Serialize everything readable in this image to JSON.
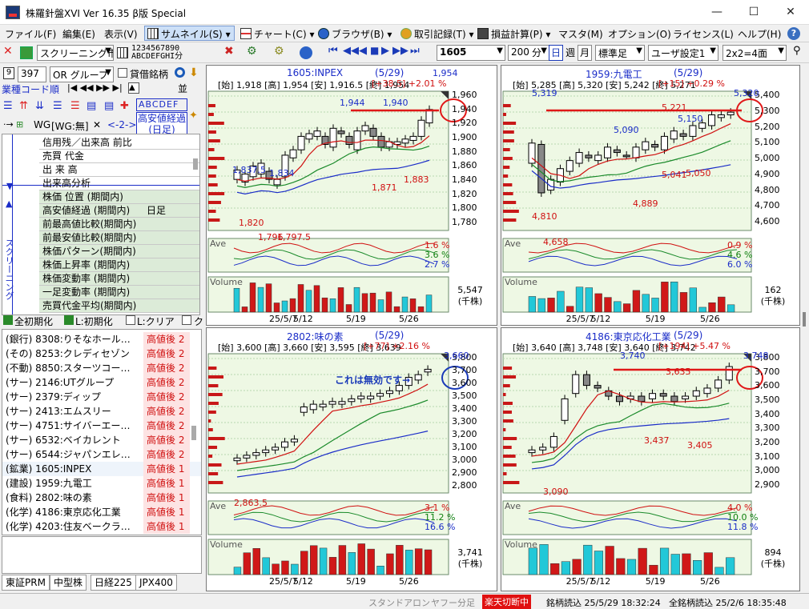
{
  "window": {
    "title": "株羅針盤XVI Ver 16.35 β版  Special",
    "min": "—",
    "max": "☐",
    "close": "✕"
  },
  "menu": [
    {
      "label": "ファイル(F)"
    },
    {
      "label": "編集(E)"
    },
    {
      "label": "表示(V)"
    },
    {
      "label": "サムネイル(S)"
    },
    {
      "label": "チャート(C)"
    },
    {
      "label": "ブラウザ(B)"
    },
    {
      "label": "取引記録(T)"
    },
    {
      "label": "損益計算(P)"
    },
    {
      "label": "マスタ(M)"
    },
    {
      "label": "オプション(O)"
    },
    {
      "label": "ライセンス(L)"
    },
    {
      "label": "ヘルプ(H)"
    }
  ],
  "toolbar": {
    "market": "スクリーニング市場",
    "digits_top": "1234567890",
    "digits_bottom": "ABCDEFGHI分",
    "code": "1605",
    "bars": "200",
    "unit": "分",
    "tf_day": "日",
    "tf_week": "週",
    "tf_month": "月",
    "standard": "標準足",
    "user": "ユーザ設定1",
    "layout": "2x2=4面"
  },
  "left": {
    "count": "397",
    "orgroup": "OR グループ",
    "lending": "貸借銘柄",
    "sector": "業種コード順",
    "abc": "ABCDEF",
    "wg": "WG",
    "wgnone": "[WG:無]",
    "nav": "<-2->",
    "high_low": "高安値経過",
    "nichi": "(日足)",
    "screening": "スクリーニング",
    "rows": [
      {
        "label": "信用残／出来高  前比",
        "val": ""
      },
      {
        "label": "売買  代金",
        "val": ""
      },
      {
        "label": "出  来  高",
        "val": ""
      },
      {
        "label": "出来高分析",
        "val": ""
      },
      {
        "label": "株価  位置  (期間内)",
        "val": ""
      },
      {
        "label": "高安値経過  (期間内)",
        "val": "日足"
      },
      {
        "label": "前最高値比較(期間内)",
        "val": ""
      },
      {
        "label": "前最安値比較(期間内)",
        "val": ""
      },
      {
        "label": "株価パターン(期間内)",
        "val": ""
      },
      {
        "label": "株価上昇率  (期間内)",
        "val": ""
      },
      {
        "label": "株価変動率  (期間内)",
        "val": ""
      },
      {
        "label": "一足変動率  (期間内)",
        "val": ""
      },
      {
        "label": "売買代金平均(期間内)",
        "val": ""
      }
    ],
    "reset_all": "全初期化",
    "reset_l": "L:初期化",
    "clear_l": "L:クリア",
    "check_k": "ク",
    "stocks": [
      {
        "name": "(銀行) 8308:りそなホール…",
        "tag": "高値後  2"
      },
      {
        "name": "(その) 8253:クレディセゾン",
        "tag": "高値後  2"
      },
      {
        "name": "(不動) 8850:スターツコー…",
        "tag": "高値後  2"
      },
      {
        "name": "(サー) 2146:UTグループ",
        "tag": "高値後  2"
      },
      {
        "name": "(サー) 2379:ディップ",
        "tag": "高値後  2"
      },
      {
        "name": "(サー) 2413:エムスリー",
        "tag": "高値後  2"
      },
      {
        "name": "(サー) 4751:サイバーエー…",
        "tag": "高値後  2"
      },
      {
        "name": "(サー) 6532:ベイカレント",
        "tag": "高値後  2"
      },
      {
        "name": "(サー) 6544:ジャパンエレ…",
        "tag": "高値後  2"
      },
      {
        "name": "(鉱業) 1605:INPEX",
        "tag": "高値後  1"
      },
      {
        "name": "(建設) 1959:九電工",
        "tag": "高値後  1"
      },
      {
        "name": "(食料) 2802:味の素",
        "tag": "高値後  1"
      },
      {
        "name": "(化学) 4186:東京応化工業",
        "tag": "高値後  1"
      },
      {
        "name": "(化学) 4203:住友ベークラ…",
        "tag": "高値後  1"
      }
    ],
    "tabs": [
      "東証PRM",
      "中型株",
      "日経225",
      "JPX400"
    ]
  },
  "status": {
    "standalone": "スタンドアロン",
    "yahoo": "ヤフー分足",
    "rakuten": "楽天切断中",
    "load1": "銘柄読込  25/5/29  18:32:24",
    "load2": "全銘柄読込  25/2/6  18:35:48"
  },
  "charts": [
    {
      "title": "1605:INPEX",
      "date": "(5/29)",
      "info": "[始] 1,918 [高] 1,954 [安] 1,916.5 [終] 1,954",
      "chg": "[+38.5] +2.01 %",
      "yticks": [
        "1,960",
        "1,940",
        "1,920",
        "1,900",
        "1,880",
        "1,860",
        "1,840",
        "1,820",
        "1,800",
        "1,780"
      ],
      "pct": [
        "1.6 %",
        "3.6 %",
        "2.7 %"
      ],
      "vol": "5,547",
      "volunit": "(千株)",
      "ave": "Ave",
      "volume": "Volume",
      "xt": [
        "25/5/7",
        "5/12",
        "5/19",
        "5/26"
      ],
      "notes": [
        {
          "t": "1,944",
          "c": "blue"
        },
        {
          "t": "1,940",
          "c": "blue"
        },
        {
          "t": "1,954",
          "c": "blue"
        },
        {
          "t": "1,837.5",
          "c": "blue"
        },
        {
          "t": "1,834",
          "c": "blue"
        },
        {
          "t": "1,871",
          "c": "red"
        },
        {
          "t": "1,883",
          "c": "red"
        },
        {
          "t": "1,820",
          "c": "red"
        },
        {
          "t": "1,796",
          "c": "red"
        },
        {
          "t": "1,797.5",
          "c": "red"
        }
      ]
    },
    {
      "title": "1959:九電工",
      "date": "(5/29)",
      "info": "[始] 5,285 [高] 5,320 [安] 5,242 [終] 5,271",
      "chg": "[+15] +0.29 %",
      "yticks": [
        "5,400",
        "5,300",
        "5,200",
        "5,100",
        "5,000",
        "4,900",
        "4,800",
        "4,700",
        "4,600"
      ],
      "pct": [
        "0.9 %",
        "4.6 %",
        "6.0 %"
      ],
      "vol": "162",
      "volunit": "(千株)",
      "ave": "Ave",
      "volume": "Volume",
      "xt": [
        "25/5/7",
        "5/12",
        "5/19",
        "5/26"
      ],
      "notes": [
        {
          "t": "5,319",
          "c": "blue"
        },
        {
          "t": "5,221",
          "c": "red"
        },
        {
          "t": "5,090",
          "c": "blue"
        },
        {
          "t": "5,150",
          "c": "blue"
        },
        {
          "t": "5,320",
          "c": "blue"
        },
        {
          "t": "5,041",
          "c": "red"
        },
        {
          "t": "5,050",
          "c": "red"
        },
        {
          "t": "4,889",
          "c": "red"
        },
        {
          "t": "4,810",
          "c": "red"
        },
        {
          "t": "4,658",
          "c": "red"
        }
      ]
    },
    {
      "title": "2802:味の素",
      "date": "(5/29)",
      "info": "[始] 3,600 [高] 3,660 [安] 3,595 [終] 3,639",
      "chg": "[+77] +2.16 %",
      "yticks": [
        "3,800",
        "3,700",
        "3,600",
        "3,500",
        "3,400",
        "3,300",
        "3,200",
        "3,100",
        "3,000",
        "2,900",
        "2,800"
      ],
      "pct": [
        "3.1 %",
        "11.2 %",
        "16.6 %"
      ],
      "vol": "3,741",
      "volunit": "(千株)",
      "ave": "Ave",
      "volume": "Volume",
      "xt": [
        "25/5/7",
        "5/12",
        "5/19",
        "5/26"
      ],
      "notes": [
        {
          "t": "3,660",
          "c": "blue"
        },
        {
          "t": "2,863.5",
          "c": "red"
        }
      ],
      "memo": "これは無効です→"
    },
    {
      "title": "4186:東京応化工業",
      "date": "(5/29)",
      "info": "[始] 3,640 [高] 3,748 [安] 3,640 [終] 3,742",
      "chg": "[+194] +5.47 %",
      "yticks": [
        "3,800",
        "3,700",
        "3,600",
        "3,500",
        "3,400",
        "3,300",
        "3,200",
        "3,100",
        "3,000",
        "2,900"
      ],
      "pct": [
        "4.0 %",
        "10.0 %",
        "11.8 %"
      ],
      "vol": "894",
      "volunit": "(千株)",
      "ave": "Ave",
      "volume": "Volume",
      "xt": [
        "25/5/7",
        "5/12",
        "5/19",
        "5/26"
      ],
      "notes": [
        {
          "t": "3,740",
          "c": "blue"
        },
        {
          "t": "3,748",
          "c": "blue"
        },
        {
          "t": "3,635",
          "c": "red"
        },
        {
          "t": "3,437",
          "c": "red"
        },
        {
          "t": "3,405",
          "c": "red"
        },
        {
          "t": "3,090",
          "c": "red"
        }
      ]
    }
  ]
}
